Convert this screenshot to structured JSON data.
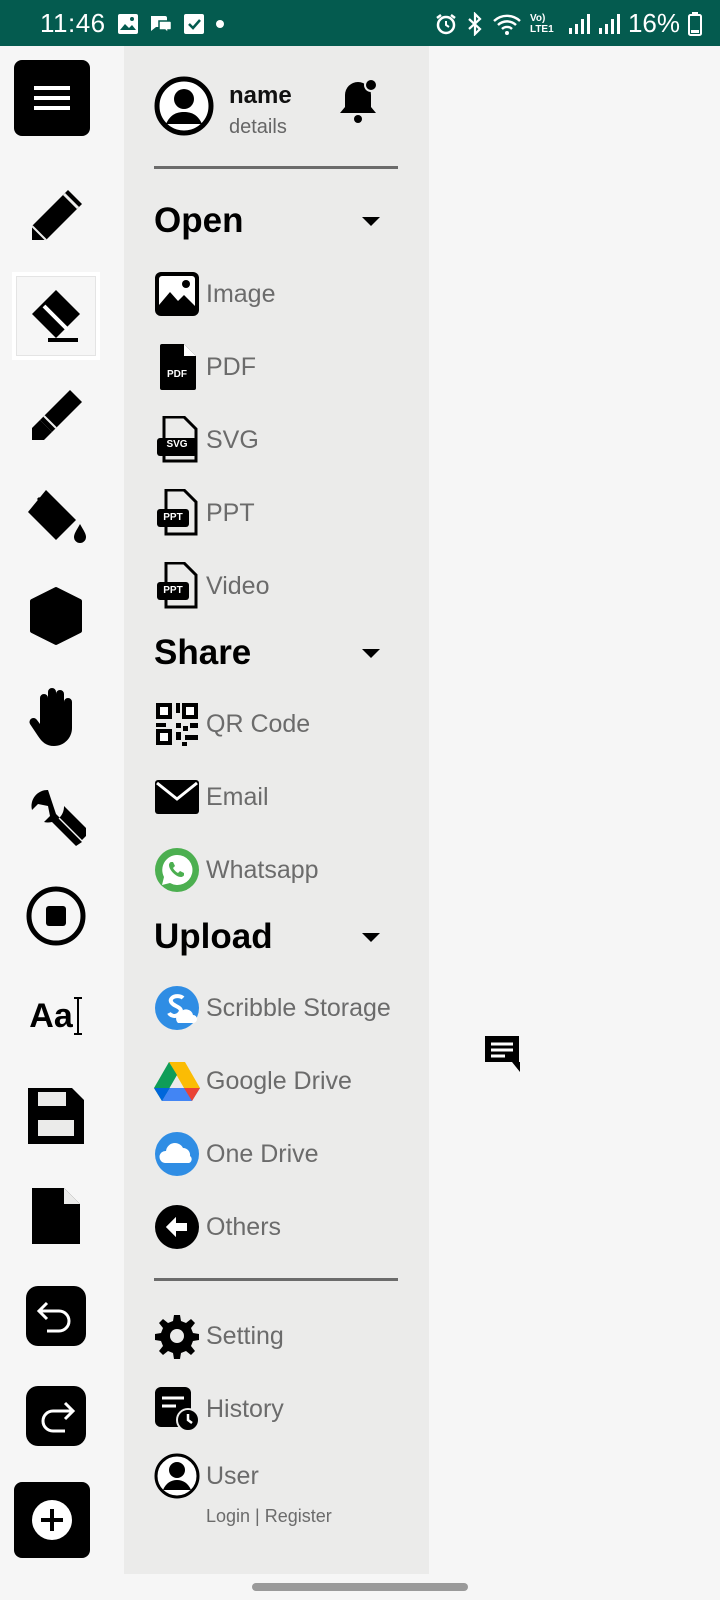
{
  "status_bar": {
    "time": "11:46",
    "network": "Vo) LTE1",
    "battery": "16%"
  },
  "toolbar": {
    "tools": [
      {
        "name": "menu",
        "icon": "menu-icon"
      },
      {
        "name": "pencil",
        "icon": "pencil-icon"
      },
      {
        "name": "eraser",
        "icon": "eraser-icon",
        "selected": true
      },
      {
        "name": "marker",
        "icon": "marker-icon"
      },
      {
        "name": "fill",
        "icon": "paint-bucket-icon"
      },
      {
        "name": "shape",
        "icon": "hexagon-icon"
      },
      {
        "name": "pan",
        "icon": "hand-icon"
      },
      {
        "name": "settings-tool",
        "icon": "wrench-icon"
      },
      {
        "name": "record",
        "icon": "stop-record-icon"
      },
      {
        "name": "text",
        "icon": "text-tool-icon",
        "label": "Aa"
      },
      {
        "name": "save",
        "icon": "floppy-icon"
      },
      {
        "name": "new-page",
        "icon": "page-icon"
      },
      {
        "name": "undo",
        "icon": "undo-icon"
      },
      {
        "name": "redo",
        "icon": "redo-icon"
      },
      {
        "name": "add",
        "icon": "plus-circle-icon"
      }
    ]
  },
  "profile": {
    "name": "name",
    "details": "details"
  },
  "sections": {
    "open": {
      "title": "Open",
      "items": [
        {
          "label": "Image",
          "icon": "image-icon"
        },
        {
          "label": "PDF",
          "icon": "pdf-file-icon",
          "badge": "PDF"
        },
        {
          "label": "SVG",
          "icon": "svg-file-icon",
          "badge": "SVG"
        },
        {
          "label": "PPT",
          "icon": "ppt-file-icon",
          "badge": "PPT"
        },
        {
          "label": "Video",
          "icon": "video-file-icon",
          "badge": "PPT"
        }
      ]
    },
    "share": {
      "title": "Share",
      "items": [
        {
          "label": "QR Code",
          "icon": "qr-code-icon"
        },
        {
          "label": "Email",
          "icon": "email-icon"
        },
        {
          "label": "Whatsapp",
          "icon": "whatsapp-icon"
        }
      ]
    },
    "upload": {
      "title": "Upload",
      "items": [
        {
          "label": "Scribble Storage",
          "icon": "scribble-storage-icon"
        },
        {
          "label": "Google Drive",
          "icon": "google-drive-icon"
        },
        {
          "label": "One Drive",
          "icon": "one-drive-icon"
        },
        {
          "label": "Others",
          "icon": "back-arrow-circle-icon"
        }
      ]
    }
  },
  "footer": {
    "setting": "Setting",
    "history": "History",
    "user": "User",
    "user_sub": "Login | Register"
  },
  "colors": {
    "status_bar": "#045b4f",
    "drawer_bg": "#ebebea",
    "label_gray": "#6b6b6b",
    "whatsapp_green": "#25d366",
    "cloud_blue": "#2f8de4"
  }
}
